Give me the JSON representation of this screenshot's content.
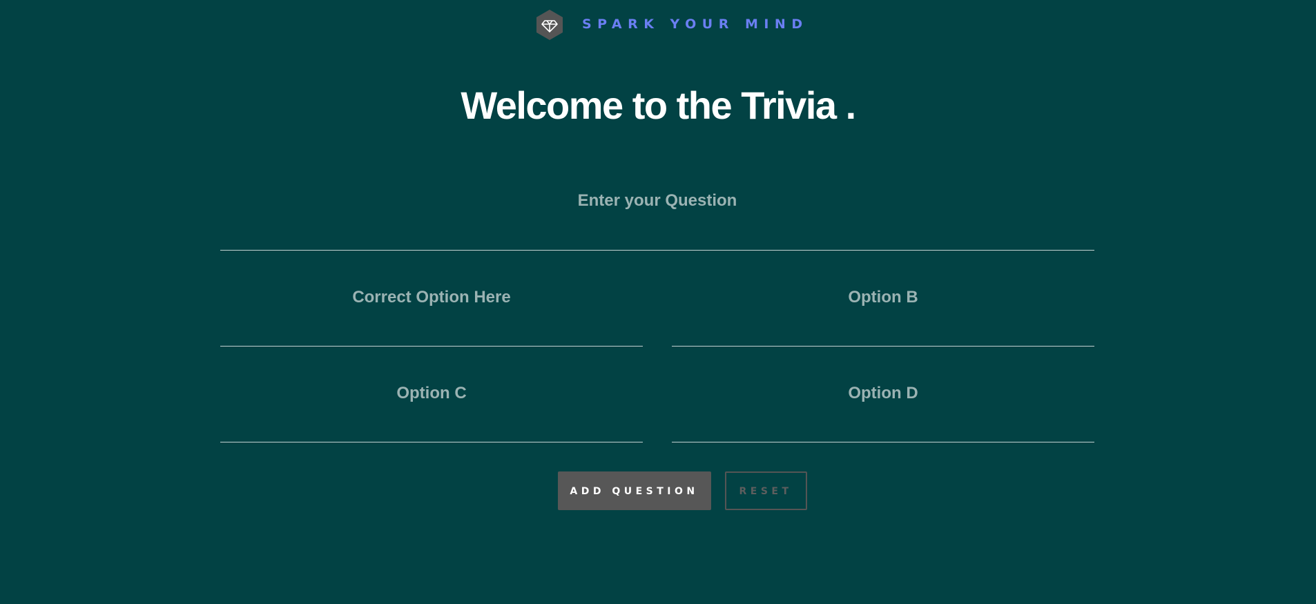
{
  "header": {
    "logo_icon": "diamond-icon",
    "brand": "SPARK YOUR MIND"
  },
  "main": {
    "title": "Welcome to the Trivia ."
  },
  "form": {
    "question_placeholder": "Enter your Question",
    "option_a_placeholder": "Correct Option Here",
    "option_b_placeholder": "Option B",
    "option_c_placeholder": "Option C",
    "option_d_placeholder": "Option D",
    "add_label": "ADD QUESTION",
    "reset_label": "RESET"
  },
  "colors": {
    "background": "#024244",
    "brand": "#6b7ff2",
    "button": "#575757"
  }
}
